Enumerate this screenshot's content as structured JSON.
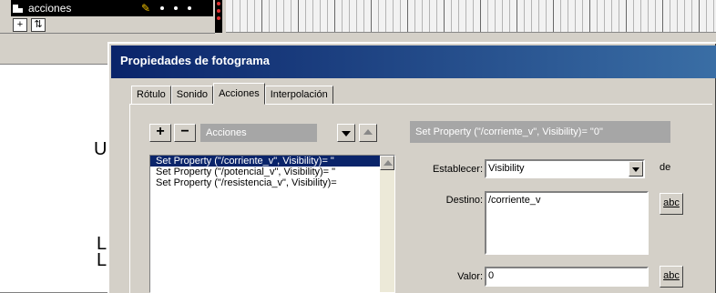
{
  "timeline": {
    "layer_name": "acciones",
    "layer_icon": "layer-icon",
    "edit_icon": "pencil-icon"
  },
  "stage": {
    "letters": [
      "U",
      "L",
      "L"
    ]
  },
  "dialog": {
    "title": "Propiedades de fotograma",
    "tabs": [
      "Rótulo",
      "Sonido",
      "Acciones",
      "Interpolación"
    ],
    "active_tab": "Acciones"
  },
  "actions_panel": {
    "add_label": "+",
    "remove_label": "−",
    "dropdown_label": "Acciones",
    "items": [
      "Set Property (\"/corriente_v\", Visibility)= \"",
      "Set Property (\"/potencial_v\", Visibility)= \"",
      "Set Property (\"/resistencia_v\", Visibility)="
    ]
  },
  "details": {
    "header": "Set Property (\"/corriente_v\", Visibility)= \"0\"",
    "establecer_label": "Establecer:",
    "establecer_value": "Visibility",
    "de_label": "de",
    "destino_label": "Destino:",
    "destino_value": "/corriente_v",
    "valor_label": "Valor:",
    "valor_value": "0",
    "abc_label": "abc"
  },
  "colors": {
    "title_bar": "#0a246a",
    "selection": "#0a246a",
    "panel_header": "#a6a6a6"
  }
}
